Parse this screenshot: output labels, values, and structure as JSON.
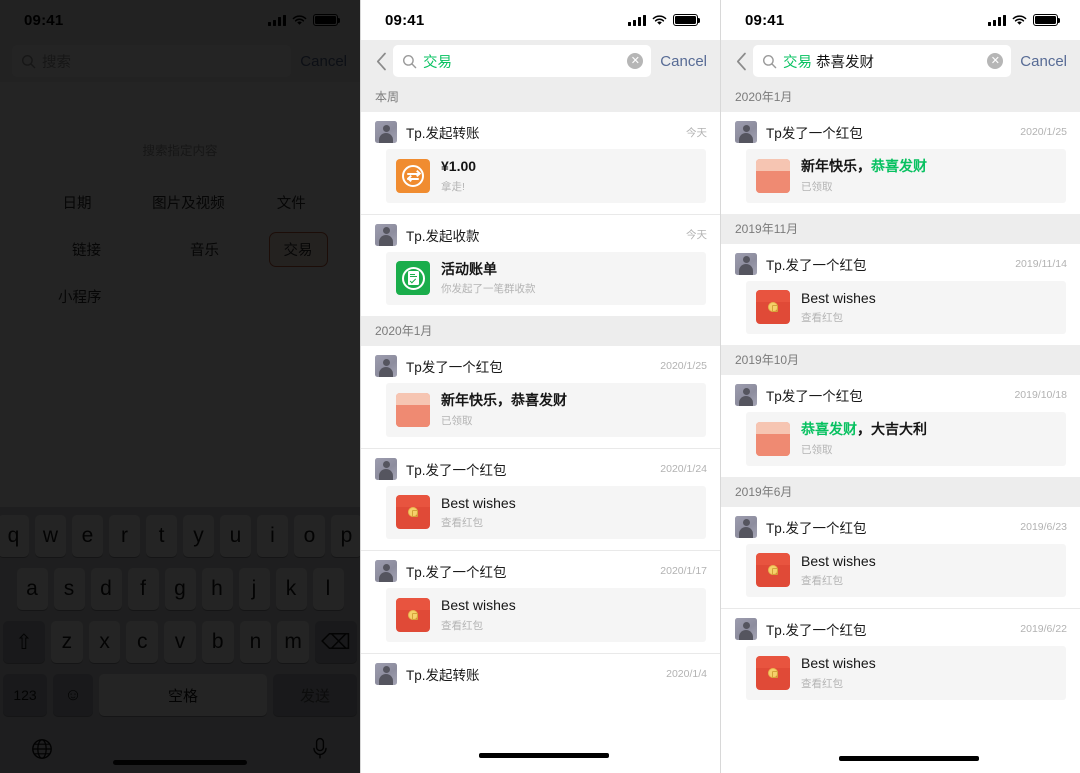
{
  "status": {
    "time": "09:41",
    "signal_icon": "cellular-bars-icon",
    "wifi_icon": "wifi-icon",
    "battery_icon": "battery-icon"
  },
  "accent": {
    "green": "#07c160",
    "link": "#576b95",
    "chip_border": "#c45a3c",
    "chip_bg": "#fdece2"
  },
  "panel1": {
    "search": {
      "placeholder": "搜索",
      "value": "",
      "cancel_label": "Cancel",
      "search_icon": "search-icon"
    },
    "hint": "搜索指定内容",
    "filters": [
      {
        "label": "日期",
        "selected": false
      },
      {
        "label": "图片及视频",
        "selected": false
      },
      {
        "label": "文件",
        "selected": false
      },
      {
        "label": "链接",
        "selected": false
      },
      {
        "label": "音乐",
        "selected": false
      },
      {
        "label": "交易",
        "selected": true
      },
      {
        "label": "小程序",
        "selected": false
      }
    ],
    "keyboard": {
      "row1": [
        "q",
        "w",
        "e",
        "r",
        "t",
        "y",
        "u",
        "i",
        "o",
        "p"
      ],
      "row2": [
        "a",
        "s",
        "d",
        "f",
        "g",
        "h",
        "j",
        "k",
        "l"
      ],
      "row3_shift": "⇧",
      "row3": [
        "z",
        "x",
        "c",
        "v",
        "b",
        "n",
        "m"
      ],
      "row3_backspace": "⌫",
      "num_label": "123",
      "emoji_label": "☺",
      "space_label": "空格",
      "send_label": "发送",
      "globe_icon": "globe-icon",
      "mic_icon": "microphone-icon"
    }
  },
  "panel2": {
    "search": {
      "keyword": "交易",
      "rest": "",
      "cancel_label": "Cancel",
      "clear_icon": "clear-icon",
      "back_icon": "back-chevron-icon"
    },
    "sections": [
      {
        "header": "本周",
        "results": [
          {
            "title": "Tp.发起转账",
            "date": "今天",
            "card": {
              "icon": "transfer-icon",
              "title": "¥1.00",
              "title_bold": true,
              "sub": "拿走!"
            }
          },
          {
            "title": "Tp.发起收款",
            "date": "今天",
            "card": {
              "icon": "bill-icon",
              "title": "活动账单",
              "title_bold": true,
              "sub": "你发起了一笔群收款"
            }
          }
        ]
      },
      {
        "header": "2020年1月",
        "results": [
          {
            "title": "Tp发了一个红包",
            "date": "2020/1/25",
            "card": {
              "icon": "redpacket-opened-icon",
              "title": "新年快乐，恭喜发财",
              "title_bold": true,
              "sub": "已领取"
            }
          },
          {
            "title": "Tp.发了一个红包",
            "date": "2020/1/24",
            "card": {
              "icon": "redpacket-icon",
              "title": "Best wishes",
              "title_bold": false,
              "sub": "查看红包"
            }
          },
          {
            "title": "Tp.发了一个红包",
            "date": "2020/1/17",
            "card": {
              "icon": "redpacket-icon",
              "title": "Best wishes",
              "title_bold": false,
              "sub": "查看红包"
            }
          },
          {
            "title": "Tp.发起转账",
            "date": "2020/1/4",
            "card": null
          }
        ]
      }
    ]
  },
  "panel3": {
    "search": {
      "keyword": "交易",
      "rest": " 恭喜发财",
      "cancel_label": "Cancel",
      "clear_icon": "clear-icon",
      "back_icon": "back-chevron-icon"
    },
    "sections": [
      {
        "header": "2020年1月",
        "results": [
          {
            "title": "Tp发了一个红包",
            "date": "2020/1/25",
            "card": {
              "icon": "redpacket-opened-icon",
              "title_plain": "新年快乐，",
              "title_kw": "恭喜发财",
              "title_bold": true,
              "sub": "已领取"
            }
          }
        ]
      },
      {
        "header": "2019年11月",
        "results": [
          {
            "title": "Tp.发了一个红包",
            "date": "2019/11/14",
            "card": {
              "icon": "redpacket-icon",
              "title_plain": "Best wishes",
              "title_kw": "",
              "title_bold": false,
              "sub": "查看红包"
            }
          }
        ]
      },
      {
        "header": "2019年10月",
        "results": [
          {
            "title": "Tp发了一个红包",
            "date": "2019/10/18",
            "card": {
              "icon": "redpacket-opened-icon",
              "title_plain": "",
              "title_kw": "恭喜发财",
              "title_tail": "，大吉大利",
              "title_bold": true,
              "sub": "已领取"
            }
          }
        ]
      },
      {
        "header": "2019年6月",
        "results": [
          {
            "title": "Tp.发了一个红包",
            "date": "2019/6/23",
            "card": {
              "icon": "redpacket-icon",
              "title_plain": "Best wishes",
              "title_kw": "",
              "title_bold": false,
              "sub": "查看红包"
            }
          },
          {
            "title": "Tp.发了一个红包",
            "date": "2019/6/22",
            "card": {
              "icon": "redpacket-icon",
              "title_plain": "Best wishes",
              "title_kw": "",
              "title_bold": false,
              "sub": "查看红包"
            }
          }
        ]
      }
    ]
  }
}
